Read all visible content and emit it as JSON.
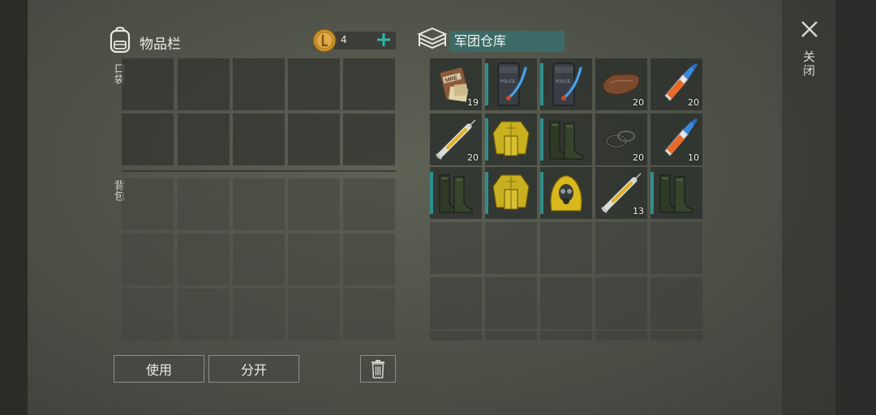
{
  "inventory": {
    "title": "物品栏",
    "coins": "4",
    "pocket_label": "口袋",
    "backpack_label": "背包"
  },
  "buttons": {
    "use": "使用",
    "split": "分开"
  },
  "warehouse": {
    "title": "军团仓库",
    "rows": [
      [
        {
          "item": "mre-ration",
          "qty": "19",
          "mark": false
        },
        {
          "item": "police-riot-shield",
          "qty": "",
          "mark": true
        },
        {
          "item": "police-riot-shield",
          "qty": "",
          "mark": true
        },
        {
          "item": "leather-scrap",
          "qty": "20",
          "mark": false
        },
        {
          "item": "glue-tube",
          "qty": "20",
          "mark": false
        }
      ],
      [
        {
          "item": "syringe",
          "qty": "20",
          "mark": false
        },
        {
          "item": "yellow-hazmat-jacket",
          "qty": "",
          "mark": true
        },
        {
          "item": "rubber-boots",
          "qty": "",
          "mark": true
        },
        {
          "item": "rubber-gaskets",
          "qty": "20",
          "mark": false
        },
        {
          "item": "glue-tube",
          "qty": "10",
          "mark": false
        }
      ],
      [
        {
          "item": "rubber-boots",
          "qty": "",
          "mark": true
        },
        {
          "item": "yellow-hazmat-jacket",
          "qty": "",
          "mark": true
        },
        {
          "item": "hazmat-hood-gasmask",
          "qty": "",
          "mark": true
        },
        {
          "item": "syringe",
          "qty": "13",
          "mark": false
        },
        {
          "item": "rubber-boots",
          "qty": "",
          "mark": true
        }
      ]
    ]
  },
  "close_label": "关闭",
  "colors": {
    "accent_teal": "#2f8f8c",
    "title_bar": "#3c6a66",
    "plus": "#2fb6a8"
  }
}
